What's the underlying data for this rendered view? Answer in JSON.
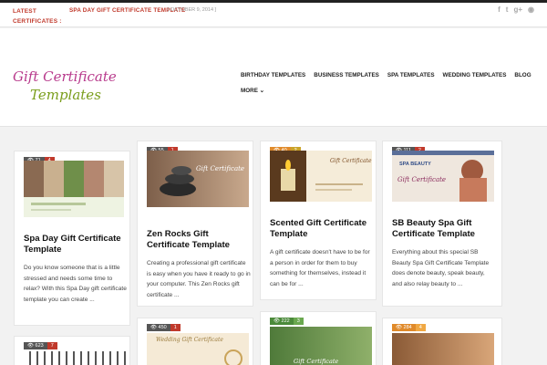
{
  "topbar": {
    "latest_label": "LATEST CERTIFICATES :",
    "ticker_title": "SPA DAY GIFT CERTIFICATE TEMPLATE",
    "ticker_date": "[ OCTOBER 9, 2014 ]",
    "social_icons": [
      "facebook-icon",
      "twitter-icon",
      "google-plus-icon",
      "rss-icon"
    ]
  },
  "logo": {
    "line1": "Gift Certificate",
    "line2": "Templates",
    "color1": "#b83a8c",
    "color2": "#7a9e1c"
  },
  "nav": {
    "items": [
      "BIRTHDAY TEMPLATES",
      "BUSINESS TEMPLATES",
      "SPA TEMPLATES",
      "WEDDING TEMPLATES",
      "BLOG"
    ],
    "more": "MORE"
  },
  "cards": [
    {
      "views": "71",
      "comments": "4",
      "title": "Spa Day Gift Certificate Template",
      "excerpt": "Do you know someone that is a little stressed and needs some time to relax? With this Spa Day gift certificate template you can create ..."
    },
    {
      "views": "55",
      "comments": "1",
      "title": "Zen Rocks Gift Certificate Template",
      "thumb_text": "Gift Certificate",
      "excerpt": "Creating a professional gift certificate is easy when you have it ready to go in your computer. This Zen Rocks gift certificate ..."
    },
    {
      "views": "40",
      "comments": "2",
      "title": "Scented Gift Certificate Template",
      "thumb_text": "Gift Certificate",
      "excerpt": "A gift certificate doesn't have to be for a person in order for them to buy something for themselves, instead it can be for ..."
    },
    {
      "views": "111",
      "comments": "2",
      "title": "SB Beauty Spa Gift Certificate Template",
      "thumb_text": "SPA BEAUTY",
      "thumb_text2": "Gift Certificate",
      "excerpt": "Everything about this special SB Beauty Spa Gift Certificate Template does denote beauty, speak beauty, and also relay beauty to ..."
    },
    {
      "views": "623",
      "comments": "7"
    },
    {
      "views": "450",
      "comments": "1",
      "thumb_text": "Wedding Gift Certificate"
    },
    {
      "views": "222",
      "comments": "3",
      "thumb_text": "Gift Certificate"
    },
    {
      "views": "284",
      "comments": "4"
    }
  ]
}
